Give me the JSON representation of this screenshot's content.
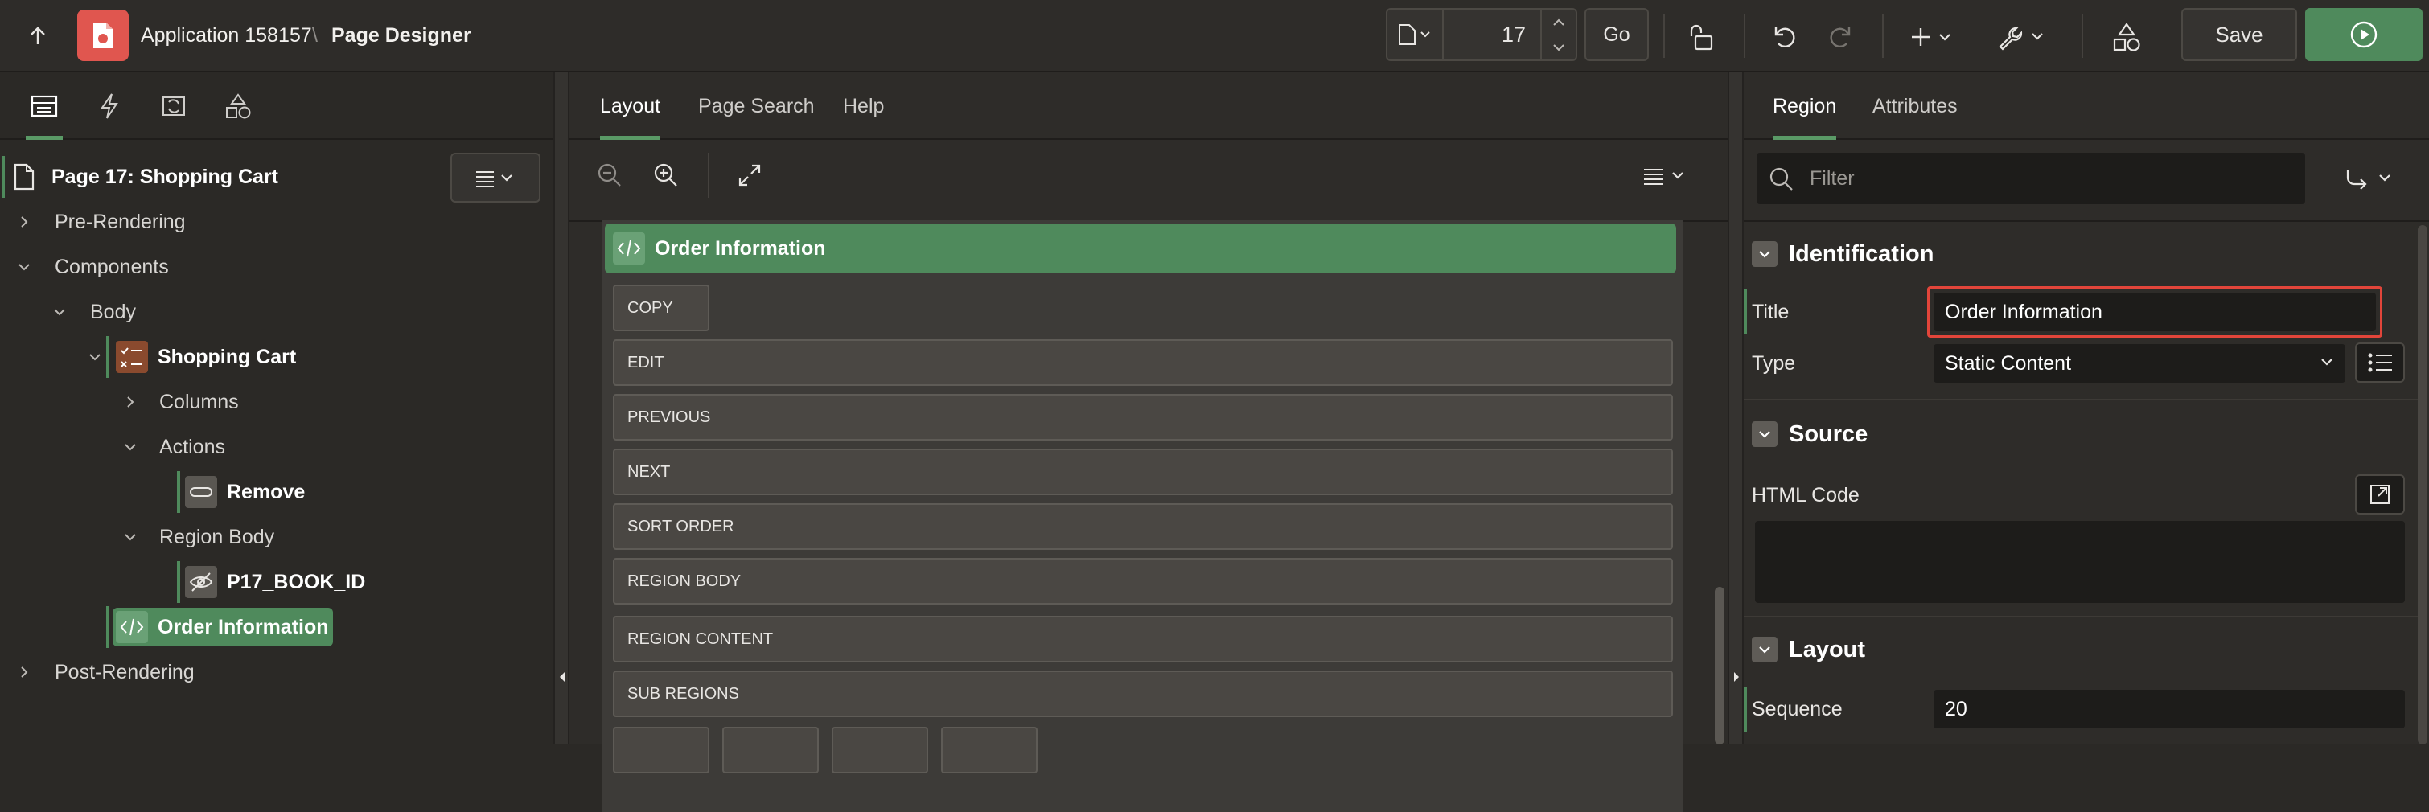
{
  "topbar": {
    "app_title": "Application 158157",
    "separator": "\\",
    "page_title": "Page Designer",
    "page_number": "17",
    "go_label": "Go",
    "save_label": "Save"
  },
  "left_pane": {
    "root_label": "Page 17: Shopping Cart",
    "tree": {
      "pre_rendering": "Pre-Rendering",
      "components": "Components",
      "body": "Body",
      "shopping_cart": "Shopping Cart",
      "columns": "Columns",
      "actions": "Actions",
      "remove": "Remove",
      "region_body": "Region Body",
      "p17_book_id": "P17_BOOK_ID",
      "order_information": "Order Information",
      "post_rendering": "Post-Rendering"
    }
  },
  "middle_pane": {
    "tabs": [
      "Layout",
      "Page Search",
      "Help"
    ],
    "region_title": "Order Information",
    "slots": [
      "COPY",
      "EDIT",
      "PREVIOUS",
      "NEXT",
      "SORT ORDER",
      "REGION BODY",
      "REGION CONTENT",
      "SUB REGIONS"
    ]
  },
  "right_pane": {
    "tabs": [
      "Region",
      "Attributes"
    ],
    "filter_placeholder": "Filter",
    "identification": {
      "heading": "Identification",
      "title_label": "Title",
      "title_value": "Order Information",
      "type_label": "Type",
      "type_value": "Static Content"
    },
    "source": {
      "heading": "Source",
      "html_code_label": "HTML Code",
      "html_code_value": ""
    },
    "layout": {
      "heading": "Layout",
      "sequence_label": "Sequence",
      "sequence_value": "20"
    }
  },
  "colors": {
    "accent_green": "#4f8a5c",
    "run_button": "#4f8a5c",
    "app_icon": "#e0564f",
    "highlight_border": "#e2453a"
  }
}
